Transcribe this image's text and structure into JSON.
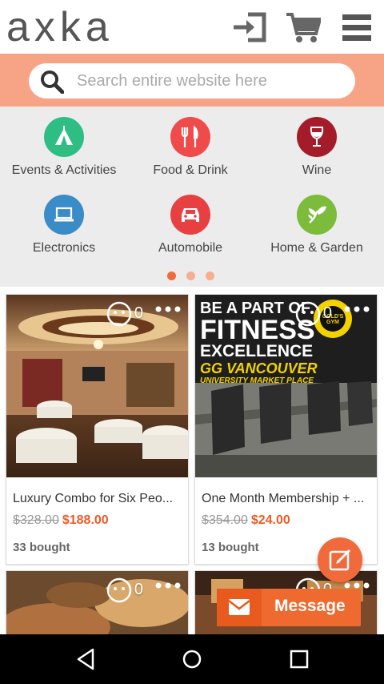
{
  "header": {
    "logo_text": "axka",
    "icons": [
      "sign-in-icon",
      "cart-icon",
      "menu-icon"
    ]
  },
  "search": {
    "placeholder": "Search entire website here"
  },
  "categories": [
    {
      "label": "Events & Activities",
      "icon": "tent-icon",
      "color": "#2ebd82"
    },
    {
      "label": "Food & Drink",
      "icon": "cutlery-icon",
      "color": "#ef4b4b"
    },
    {
      "label": "Wine",
      "icon": "wine-glass-icon",
      "color": "#a41c2a"
    },
    {
      "label": "Electronics",
      "icon": "laptop-icon",
      "color": "#3a8cc9"
    },
    {
      "label": "Automobile",
      "icon": "car-icon",
      "color": "#e84040"
    },
    {
      "label": "Home & Garden",
      "icon": "plant-icon",
      "color": "#7dbb3b"
    }
  ],
  "pager": {
    "pages": 3,
    "active": 0
  },
  "deals": [
    {
      "title": "Luxury Combo for Six Peo...",
      "old_price": "$328.00",
      "new_price": "$188.00",
      "bought": "33 bought",
      "comments": "0"
    },
    {
      "title": "One Month Membership + ...",
      "old_price": "$354.00",
      "new_price": "$24.00",
      "bought": "13 bought",
      "comments": "0",
      "ad": {
        "line1": "BE A PART OF",
        "line2": "FITNESS",
        "line3": "EXCELLENCE",
        "line4": "GG VANCOUVER",
        "line5": "UNIVERSITY MARKET PLACE",
        "badge": "GOLD'S GYM"
      }
    },
    {
      "comments": "0"
    },
    {
      "comments": "0"
    }
  ],
  "message_button": {
    "label": "Message"
  },
  "colors": {
    "accent": "#ee6a2f",
    "search_band": "#f6a485"
  }
}
